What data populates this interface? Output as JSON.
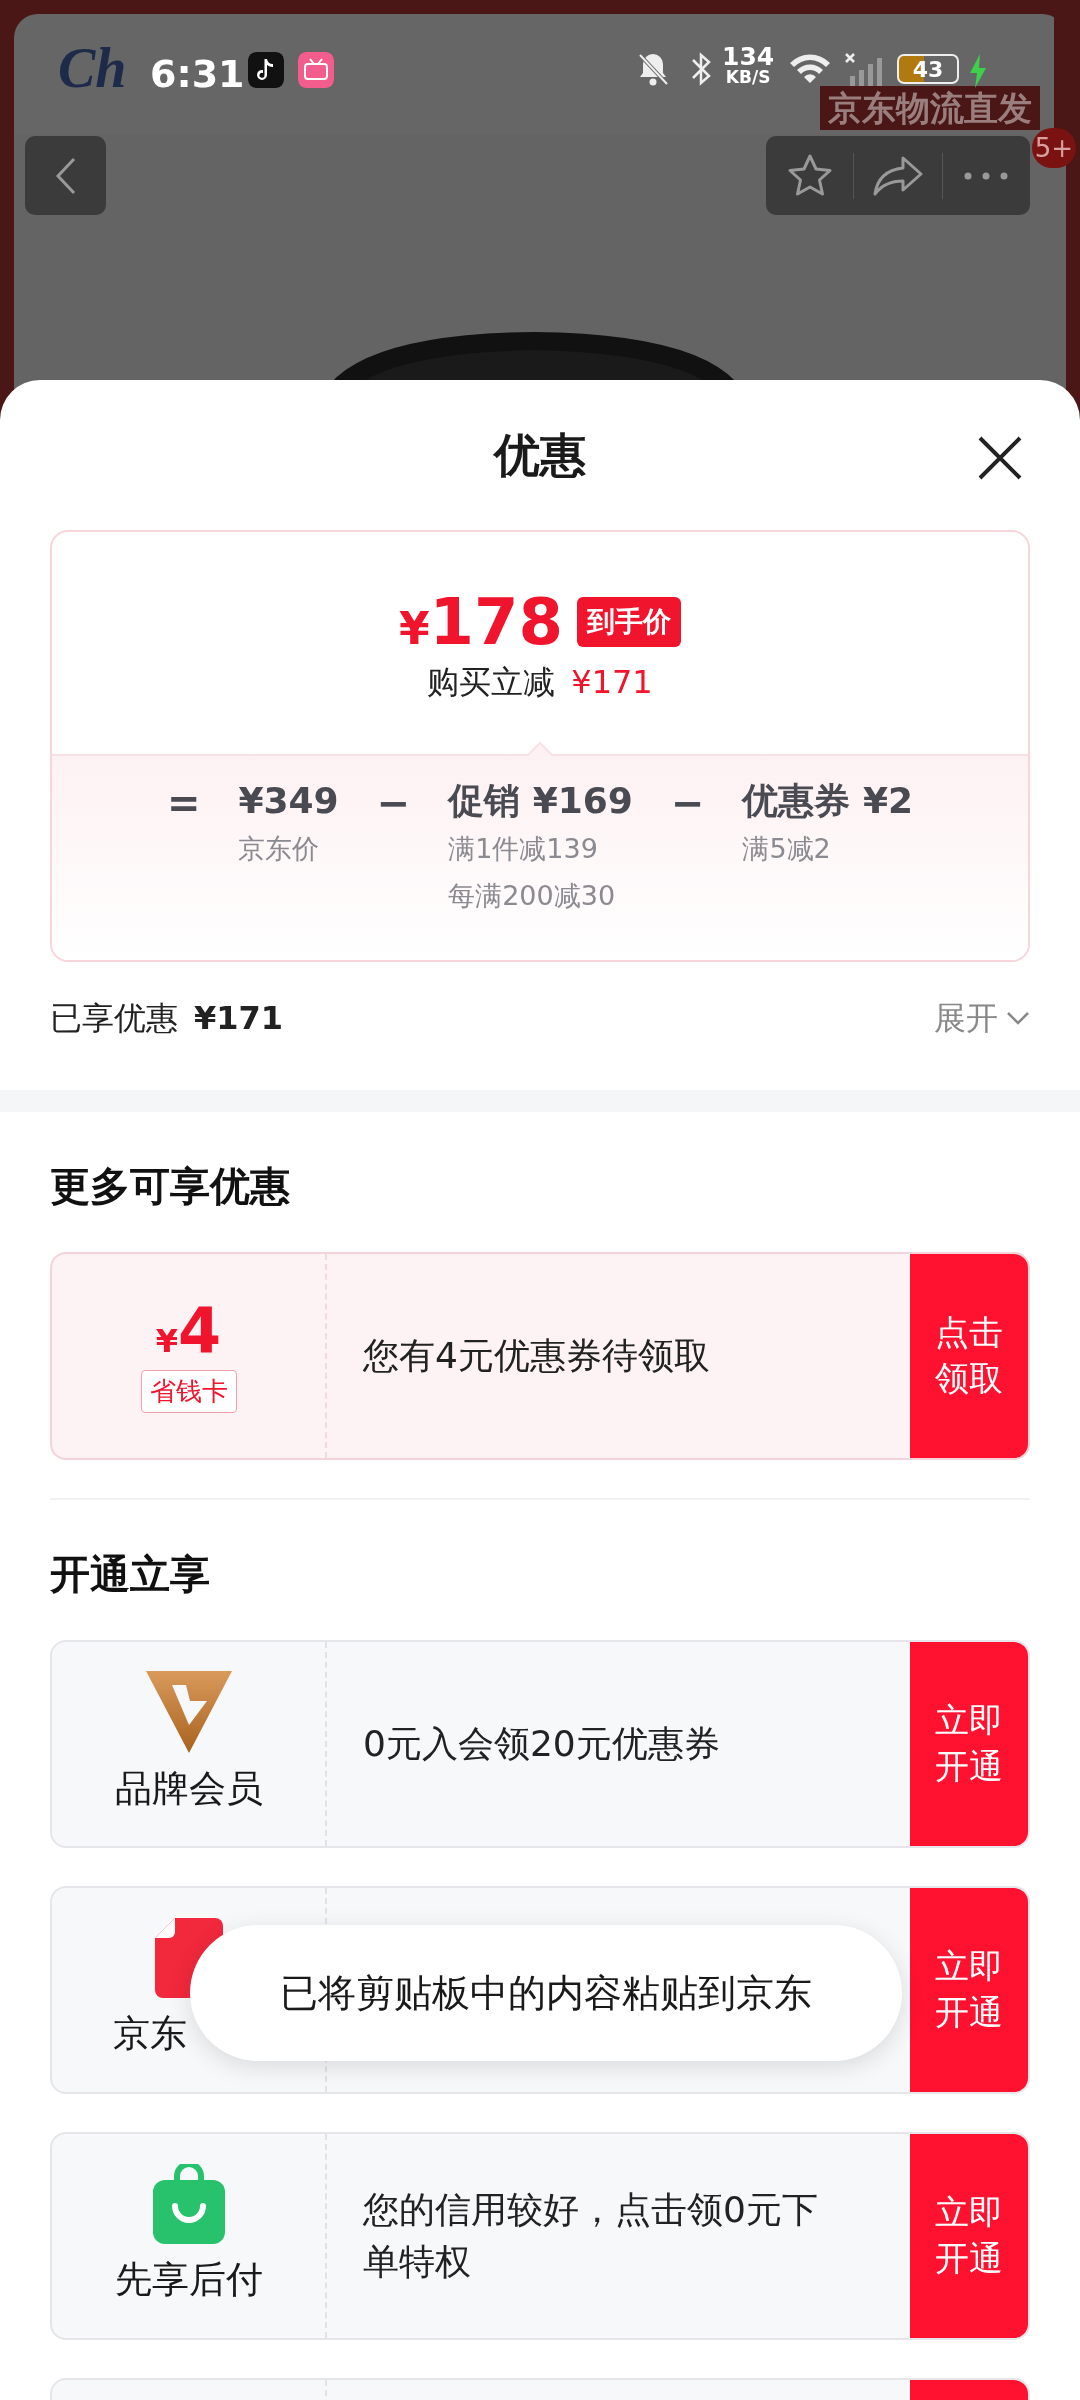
{
  "status_bar": {
    "time": "6:31",
    "speed_value": "134",
    "speed_unit": "KB/S",
    "battery": "43",
    "charging": true
  },
  "background_page": {
    "brand_logo": "Ch",
    "banner": "京东物流直发",
    "badge": "5+"
  },
  "sheet": {
    "title": "优惠",
    "price_card": {
      "final_price": "178",
      "currency": "¥",
      "final_tag": "到手价",
      "saving_label": "购买立减",
      "saving_amount": "¥171",
      "breakdown": [
        {
          "operator": "=",
          "title": "¥349",
          "notes": [
            "京东价"
          ]
        },
        {
          "operator": "−",
          "title": "促销 ¥169",
          "notes": [
            "满1件减139",
            "每满200减30"
          ]
        },
        {
          "operator": "−",
          "title": "优惠券 ¥2",
          "notes": [
            "满5减2"
          ]
        }
      ]
    },
    "enjoyed": {
      "label": "已享优惠",
      "amount": "¥171",
      "toggle": "展开",
      "expanded": false
    },
    "sections": [
      {
        "heading": "更多可享优惠",
        "offers": [
          {
            "kind": "coupon",
            "currency": "¥",
            "amount": "4",
            "tag": "省钱卡",
            "text": "您有4元优惠券待领取",
            "action": "点击领取"
          }
        ]
      },
      {
        "heading": "开通立享",
        "offers": [
          {
            "kind": "brand",
            "label": "品牌会员",
            "text": "0元入会领20元优惠券",
            "action": "立即开通"
          },
          {
            "kind": "baitiao",
            "label": "京东",
            "action": "立即开通"
          },
          {
            "kind": "paylater",
            "label": "先享后付",
            "text": "您的信用较好，点击领0元下单特权",
            "action": "立即开通"
          },
          {
            "kind": "partial"
          }
        ]
      }
    ]
  },
  "toast": {
    "text": "已将剪贴板中的内容粘贴到京东"
  }
}
